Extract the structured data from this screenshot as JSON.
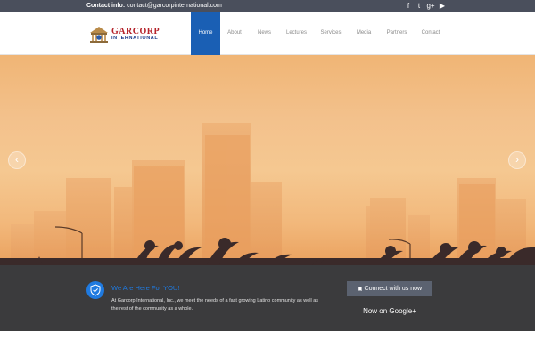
{
  "topbar": {
    "contact_label": "Contact info:",
    "contact_email": "contact@garcorpinternational.com",
    "social": [
      {
        "icon": "facebook-icon",
        "glyph": "f"
      },
      {
        "icon": "twitter-icon",
        "glyph": "t"
      },
      {
        "icon": "google-plus-icon",
        "glyph": "g+"
      },
      {
        "icon": "youtube-icon",
        "glyph": "▶"
      }
    ]
  },
  "header": {
    "logo_line1": "GARCORP",
    "logo_line2": "INTERNATIONAL",
    "nav": [
      "Home",
      "About",
      "News",
      "Lectures",
      "Services",
      "Media",
      "Partners",
      "Contact"
    ],
    "active_nav": "Home"
  },
  "hero": {
    "prev_glyph": "‹",
    "next_glyph": "›"
  },
  "strip": {
    "title": "We Are Here For YOU!",
    "text": "At Garcorp International, Inc., we meet the needs of a fast growing Latino community as well as the rest of the community as a whole.",
    "cta_label": "Connect with us now",
    "cta_sub": "Now on Google+"
  },
  "colors": {
    "topbar": "#4a4f5c",
    "nav_active": "#1a5fb4",
    "strip_bg": "#3b3b3d",
    "accent": "#1f7ae0",
    "cta_bg": "#5b6270"
  }
}
